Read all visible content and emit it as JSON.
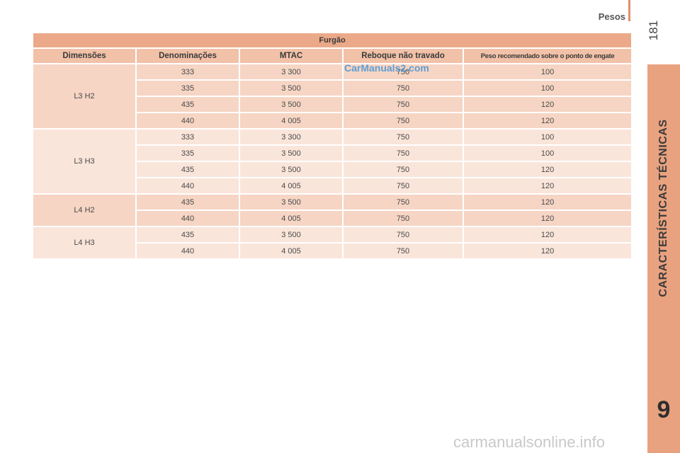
{
  "header": {
    "title": "Pesos",
    "page_number": "181"
  },
  "side_tab": {
    "label": "CARACTERÍSTICAS TÉCNICAS",
    "chapter": "9"
  },
  "watermark": {
    "top": "CarManuals2.com",
    "bottom": "carmanualsonline.info"
  },
  "table": {
    "caption": "Furgão",
    "columns": [
      "Dimensões",
      "Denominações",
      "MTAC",
      "Reboque não travado",
      "Peso recomendado sobre o ponto de engate"
    ],
    "groups": [
      {
        "dimension": "L3 H2",
        "rows": [
          [
            "333",
            "3 300",
            "750",
            "100"
          ],
          [
            "335",
            "3 500",
            "750",
            "100"
          ],
          [
            "435",
            "3 500",
            "750",
            "120"
          ],
          [
            "440",
            "4 005",
            "750",
            "120"
          ]
        ]
      },
      {
        "dimension": "L3 H3",
        "rows": [
          [
            "333",
            "3 300",
            "750",
            "100"
          ],
          [
            "335",
            "3 500",
            "750",
            "100"
          ],
          [
            "435",
            "3 500",
            "750",
            "120"
          ],
          [
            "440",
            "4 005",
            "750",
            "120"
          ]
        ]
      },
      {
        "dimension": "L4 H2",
        "rows": [
          [
            "435",
            "3 500",
            "750",
            "120"
          ],
          [
            "440",
            "4 005",
            "750",
            "120"
          ]
        ]
      },
      {
        "dimension": "L4 H3",
        "rows": [
          [
            "435",
            "3 500",
            "750",
            "120"
          ],
          [
            "440",
            "4 005",
            "750",
            "120"
          ]
        ]
      }
    ]
  },
  "colors": {
    "caption_bg": "#eba989",
    "header_bg": "#f1c1a8",
    "group_dark_bg": "#f6d5c4",
    "group_light_bg": "#fae5da",
    "side_tab_bg": "#e9a27f"
  }
}
